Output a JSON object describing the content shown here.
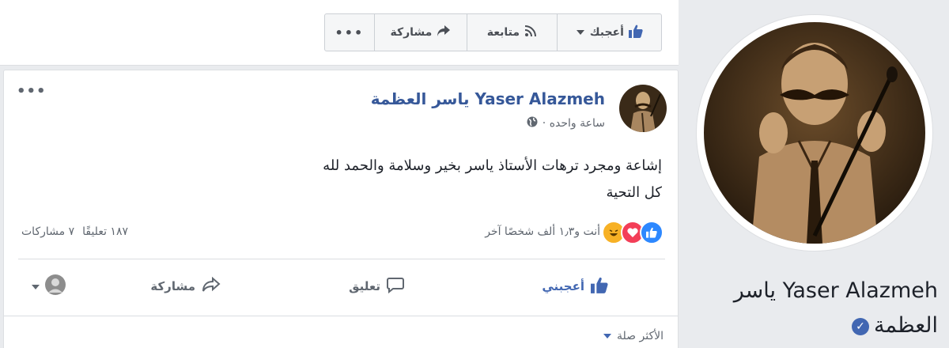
{
  "action_bar": {
    "more_label": "•••",
    "share_label": "مشاركة",
    "follow_label": "متابعة",
    "like_label": "أعجبك"
  },
  "post": {
    "author": "Yaser Alazmeh ياسر العظمة",
    "time": "ساعة واحده ·",
    "audience_icon": "globe-icon",
    "text_line1": "إشاعة ومجرد ترهات الأستاذ ياسر بخير وسلامة والحمد لله",
    "text_line2": "كل التحية",
    "reactions_summary": "أنت و١٫٣ ألف شخصًا آخر",
    "reaction_types": [
      "like",
      "love",
      "haha"
    ],
    "comments_count": "١٨٧ تعليقًا",
    "shares_count": "٧ مشاركات",
    "actions": {
      "like": "أعجبني",
      "comment": "تعليق",
      "share": "مشاركة"
    },
    "comment_sort": "الأكثر صلة"
  },
  "profile": {
    "name": "Yaser Alazmeh ياسر العظمة",
    "verified": true
  },
  "colors": {
    "brand_blue": "#4267b2",
    "link_blue": "#365899",
    "like_blue": "#2d88ff",
    "love_red": "#f33e58",
    "haha_yellow": "#f7b125"
  }
}
